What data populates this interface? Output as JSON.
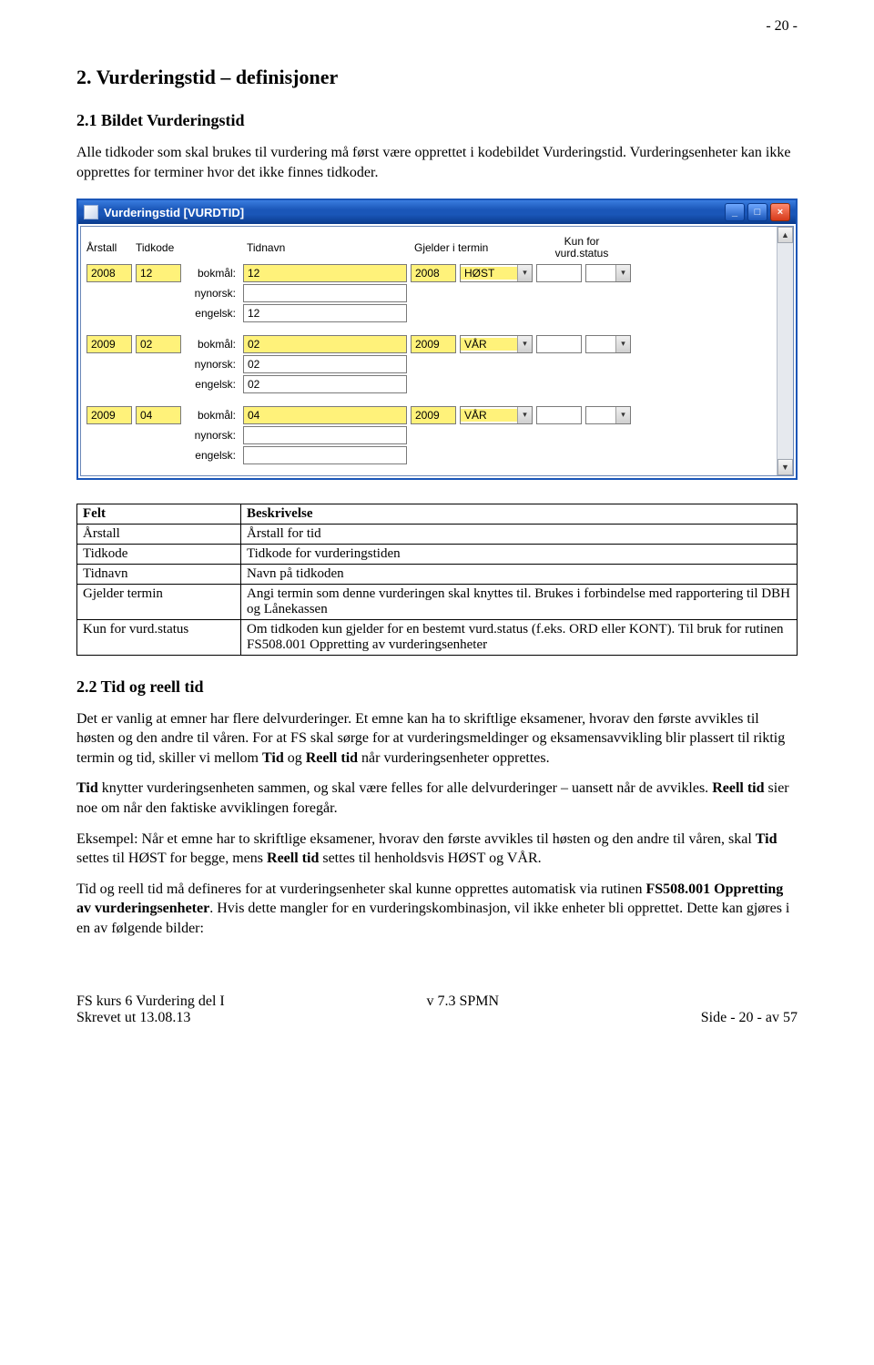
{
  "page_number_top": "- 20 -",
  "section_title": "2. Vurderingstid – definisjoner",
  "sub1_title": "2.1 Bildet Vurderingstid",
  "intro_para": "Alle tidkoder som skal brukes til vurdering må først være opprettet i kodebildet Vurderingstid. Vurderingsenheter kan ikke opprettes for terminer hvor det ikke finnes tidkoder.",
  "window": {
    "title": "Vurderingstid   [VURDTID]",
    "hdr": {
      "aarstall": "Årstall",
      "tidkode": "Tidkode",
      "tidnavn": "Tidnavn",
      "gjelder": "Gjelder i termin",
      "kunfor": "Kun for vurd.status"
    },
    "langs": {
      "bokmal": "bokmål:",
      "nynorsk": "nynorsk:",
      "engelsk": "engelsk:"
    },
    "rows": [
      {
        "aar": "2008",
        "kode": "12",
        "bokmal": "12",
        "nynorsk": "",
        "engelsk": "12",
        "g_aar": "2008",
        "g_term": "HØST",
        "stat1": "",
        "stat2": ""
      },
      {
        "aar": "2009",
        "kode": "02",
        "bokmal": "02",
        "nynorsk": "02",
        "engelsk": "02",
        "g_aar": "2009",
        "g_term": "VÅR",
        "stat1": "",
        "stat2": ""
      },
      {
        "aar": "2009",
        "kode": "04",
        "bokmal": "04",
        "nynorsk": "",
        "engelsk": "",
        "g_aar": "2009",
        "g_term": "VÅR",
        "stat1": "",
        "stat2": ""
      }
    ]
  },
  "desc_table": {
    "hdr_felt": "Felt",
    "hdr_besk": "Beskrivelse",
    "rows": [
      {
        "f": "Årstall",
        "b": "Årstall for tid"
      },
      {
        "f": "Tidkode",
        "b": "Tidkode for vurderingstiden"
      },
      {
        "f": "Tidnavn",
        "b": "Navn på tidkoden"
      },
      {
        "f": "Gjelder termin",
        "b": "Angi termin som denne vurderingen skal knyttes til. Brukes i forbindelse med rapportering til DBH og Lånekassen"
      },
      {
        "f": "Kun for vurd.status",
        "b": "Om tidkoden kun gjelder for en bestemt vurd.status (f.eks. ORD eller KONT). Til bruk for rutinen FS508.001 Oppretting av vurderingsenheter"
      }
    ]
  },
  "sub2_title": "2.2 Tid og reell tid",
  "p2a_pre": "Det er vanlig at emner har flere delvurderinger. Et emne kan ha to skriftlige eksamener, hvorav den første avvikles til høsten og den andre til våren. For at FS skal sørge for at vurderingsmeldinger og eksamensavvikling blir plassert til riktig termin og tid, skiller vi mellom ",
  "p2a_b1": "Tid",
  "p2a_mid": " og ",
  "p2a_b2": "Reell tid",
  "p2a_post": " når vurderingsenheter opprettes.",
  "p2b_b1": "Tid",
  "p2b_mid": " knytter vurderingsenheten sammen, og skal være felles for alle delvurderinger – uansett når de avvikles. ",
  "p2b_b2": "Reell tid",
  "p2b_post": " sier noe om når den faktiske avviklingen foregår.",
  "p2c_pre": "Eksempel: Når et emne har to skriftlige eksamener, hvorav den første avvikles til høsten og den andre til våren, skal ",
  "p2c_b1": "Tid",
  "p2c_mid1": " settes til HØST for begge, mens ",
  "p2c_b2": "Reell tid",
  "p2c_post": " settes til henholdsvis HØST og VÅR.",
  "p2d_pre": "Tid og reell tid må defineres for at vurderingsenheter skal kunne opprettes automatisk via rutinen ",
  "p2d_b": "FS508.001 Oppretting av vurderingsenheter",
  "p2d_post": ". Hvis dette mangler for en vurderingskombinasjon, vil ikke enheter bli opprettet. Dette kan gjøres i en av følgende bilder:",
  "footer": {
    "left1": "FS kurs 6 Vurdering del I",
    "left2": "Skrevet ut 13.08.13",
    "center": "v 7.3 SPMN",
    "right": "Side - 20 - av 57"
  }
}
